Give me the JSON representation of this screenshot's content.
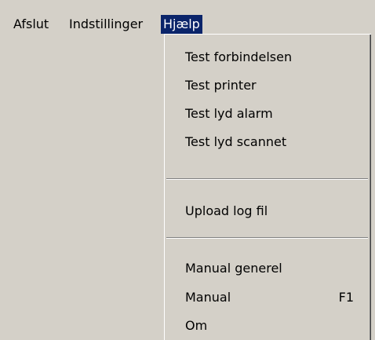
{
  "menubar": {
    "items": [
      {
        "label": "Afslut"
      },
      {
        "label": "Indstillinger"
      },
      {
        "label": "Hjælp"
      }
    ]
  },
  "help_menu": {
    "items": [
      {
        "label": "Test forbindelsen"
      },
      {
        "label": "Test printer"
      },
      {
        "label": "Test lyd alarm"
      },
      {
        "label": "Test lyd scannet"
      },
      {
        "label": "Upload log fil"
      },
      {
        "label": "Manual generel"
      },
      {
        "label": "Manual",
        "shortcut": "F1"
      },
      {
        "label": "Om"
      }
    ]
  },
  "colors": {
    "face": "#d4d0c8",
    "highlight": "#0a246a",
    "highlight_text": "#ffffff"
  }
}
